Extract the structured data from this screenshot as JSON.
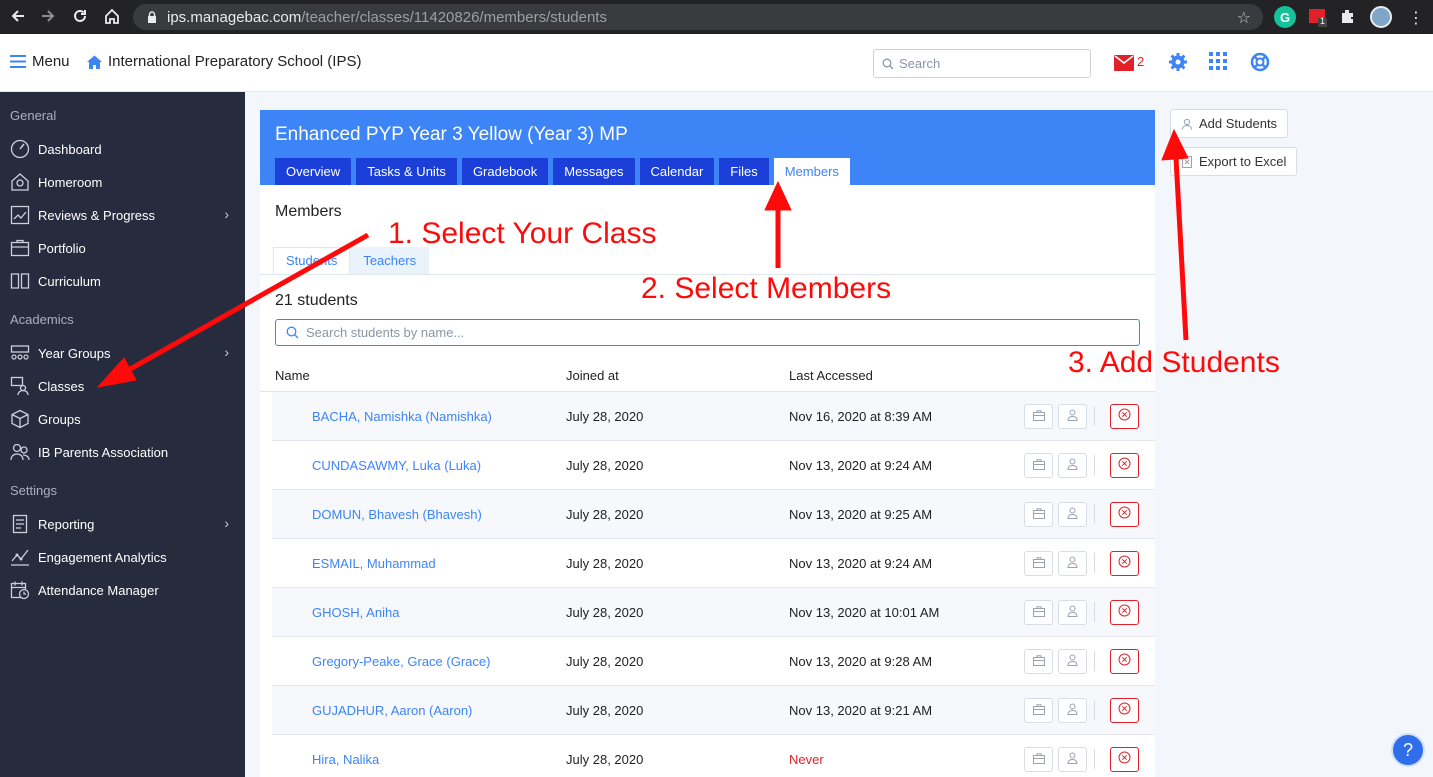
{
  "browser": {
    "url_host": "ips.managebac.com",
    "url_path": "/teacher/classes/11420826/members/students",
    "extension_badge": "1"
  },
  "header": {
    "menu_label": "Menu",
    "school_name": "International Preparatory School (IPS)",
    "search_placeholder": "Search",
    "mail_count": "2"
  },
  "sidebar": {
    "sections": {
      "general": "General",
      "academics": "Academics",
      "settings": "Settings"
    },
    "items": [
      {
        "label": "Dashboard",
        "icon": "dashboard-icon"
      },
      {
        "label": "Homeroom",
        "icon": "homeroom-icon"
      },
      {
        "label": "Reviews & Progress",
        "icon": "chart-icon",
        "has_submenu": true
      },
      {
        "label": "Portfolio",
        "icon": "portfolio-icon"
      },
      {
        "label": "Curriculum",
        "icon": "book-icon"
      },
      {
        "label": "Year Groups",
        "icon": "year-groups-icon",
        "has_submenu": true
      },
      {
        "label": "Classes",
        "icon": "classes-icon"
      },
      {
        "label": "Groups",
        "icon": "cube-icon"
      },
      {
        "label": "IB Parents Association",
        "icon": "people-icon"
      },
      {
        "label": "Reporting",
        "icon": "reporting-icon",
        "has_submenu": true
      },
      {
        "label": "Engagement Analytics",
        "icon": "analytics-icon"
      },
      {
        "label": "Attendance Manager",
        "icon": "calendar-clock-icon"
      }
    ]
  },
  "class": {
    "title": "Enhanced PYP Year 3 Yellow (Year 3) MP",
    "tabs": [
      "Overview",
      "Tasks & Units",
      "Gradebook",
      "Messages",
      "Calendar",
      "Files",
      "Members"
    ],
    "active_tab": "Members"
  },
  "members": {
    "title": "Members",
    "subtabs": [
      "Students",
      "Teachers"
    ],
    "active_subtab": "Students",
    "count_label": "21 students",
    "search_placeholder": "Search students by name...",
    "columns": {
      "name": "Name",
      "joined": "Joined at",
      "last_accessed": "Last Accessed"
    },
    "students": [
      {
        "name": "BACHA, Namishka (Namishka)",
        "joined": "July 28, 2020",
        "last_accessed": "Nov 16, 2020 at 8:39 AM"
      },
      {
        "name": "CUNDASAWMY, Luka (Luka)",
        "joined": "July 28, 2020",
        "last_accessed": "Nov 13, 2020 at 9:24 AM"
      },
      {
        "name": "DOMUN, Bhavesh (Bhavesh)",
        "joined": "July 28, 2020",
        "last_accessed": "Nov 13, 2020 at 9:25 AM"
      },
      {
        "name": "ESMAIL, Muhammad",
        "joined": "July 28, 2020",
        "last_accessed": "Nov 13, 2020 at 9:24 AM"
      },
      {
        "name": "GHOSH, Aniha",
        "joined": "July 28, 2020",
        "last_accessed": "Nov 13, 2020 at 10:01 AM"
      },
      {
        "name": "Gregory-Peake, Grace (Grace)",
        "joined": "July 28, 2020",
        "last_accessed": "Nov 13, 2020 at 9:28 AM"
      },
      {
        "name": "GUJADHUR, Aaron (Aaron)",
        "joined": "July 28, 2020",
        "last_accessed": "Nov 13, 2020 at 9:21 AM"
      },
      {
        "name": "Hira, Nalika",
        "joined": "July 28, 2020",
        "last_accessed": "Never"
      }
    ]
  },
  "actions": {
    "add_students": "Add Students",
    "export_excel": "Export to Excel"
  },
  "annotations": {
    "step1": "1. Select Your Class",
    "step2": "2. Select Members",
    "step3": "3. Add Students"
  },
  "help": {
    "label": "?"
  },
  "colors": {
    "accent": "#3d84f7",
    "tab_dark": "#1b3fd8",
    "sidebar_bg": "#262c3d",
    "annotation_red": "#ff0a0a"
  }
}
